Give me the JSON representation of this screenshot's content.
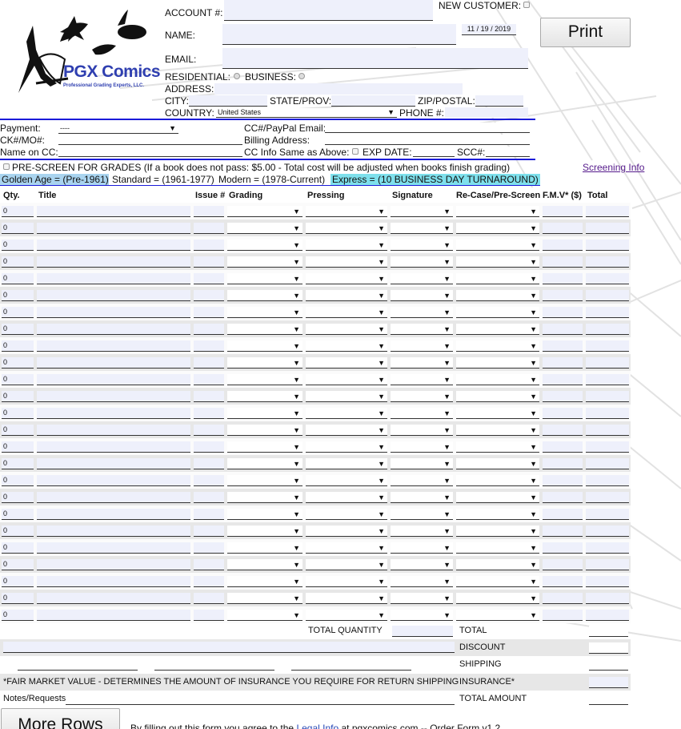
{
  "header": {
    "account_label": "ACCOUNT #:",
    "new_customer_label": "NEW CUSTOMER:",
    "name_label": "NAME:",
    "date_value": "11 / 19 / 2019",
    "email_label": "EMAIL:",
    "residential_label": "RESIDENTIAL:",
    "business_label": "BUSINESS:",
    "address_label": "ADDRESS:",
    "city_label": "CITY:",
    "state_label": "STATE/PROV:",
    "zip_label": "ZIP/POSTAL:",
    "country_label": "COUNTRY:",
    "country_value": "United States",
    "phone_label": "PHONE #:",
    "print_label": "Print"
  },
  "logo": {
    "title": "PGX Comics",
    "subtitle": "Professional Grading Experts, LLC."
  },
  "payment": {
    "payment_label": "Payment:",
    "payment_value": "----",
    "ck_label": "CK#/MO#:",
    "name_on_cc_label": "Name on CC:",
    "cc_email_label": "CC#/PayPal Email:",
    "billing_label": "Billing Address:",
    "cc_same_label": "CC Info Same as Above:",
    "exp_label": "EXP DATE:",
    "scc_label": "SCC#:"
  },
  "prescreen": {
    "text": "PRE-SCREEN FOR GRADES (If a book does not pass: $5.00 - Total cost will be adjusted when books finish grading)",
    "screening_link": "Screening Info"
  },
  "grades": {
    "golden": "Golden Age = (Pre-1961)",
    "standard": "Standard = (1961-1977)",
    "modern": "Modern = (1978-Current)",
    "express": "Express = (10 BUSINESS DAY TURNAROUND)"
  },
  "table": {
    "columns": [
      "Qty.",
      "Title",
      "Issue #",
      "Grading",
      "Pressing",
      "Signature",
      "Re-Case/Pre-Screen",
      "F.M.V* ($)",
      "Total"
    ],
    "qty_default": "0",
    "row_count": 25
  },
  "totals": {
    "total_quantity": "TOTAL QUANTITY",
    "total": "TOTAL",
    "discount": "DISCOUNT",
    "shipping": "SHIPPING",
    "fmv_note": "*FAIR MARKET VALUE - DETERMINES THE AMOUNT OF INSURANCE YOU REQUIRE FOR RETURN SHIPPING",
    "insurance": "INSURANCE*",
    "notes": "Notes/Requests",
    "total_amount": "TOTAL AMOUNT"
  },
  "footer": {
    "more_rows": "More Rows",
    "agree_prefix": "By filling out this form you agree to the ",
    "legal_link": "Legal Info",
    "agree_suffix": " at pgxcomics.com -- Order Form v1.2"
  },
  "colors": {
    "rule_blue": "#1b1bd9",
    "field_fill": "#eef0fb",
    "grade_golden": "#a9d4ef",
    "grade_express": "#7ee0ec",
    "logo_blue": "#2f3fb0"
  }
}
